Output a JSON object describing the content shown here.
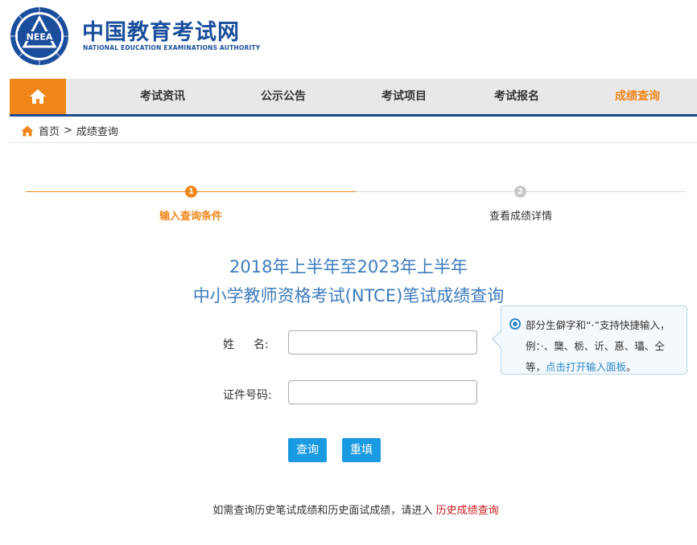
{
  "header": {
    "logo_cn": "中国教育考试网",
    "logo_en": "NATIONAL EDUCATION EXAMINATIONS AUTHORITY",
    "emblem_text": "NEEA",
    "brand_color": "#1a4e9c"
  },
  "nav": {
    "home_icon": "home-icon",
    "items": [
      {
        "label": "考试资讯"
      },
      {
        "label": "公示公告"
      },
      {
        "label": "考试项目"
      },
      {
        "label": "考试报名"
      },
      {
        "label": "成绩查询"
      }
    ],
    "active_color": "#f08519"
  },
  "breadcrumb": {
    "home": "首页",
    "separator": ">",
    "current": "成绩查询"
  },
  "steps": [
    {
      "num": "1",
      "label": "输入查询条件"
    },
    {
      "num": "2",
      "label": "查看成绩详情"
    }
  ],
  "title": {
    "line1": "2018年上半年至2023年上半年",
    "line2": "中小学教师资格考试(NTCE)笔试成绩查询"
  },
  "form": {
    "name_label_a": "姓",
    "name_label_b": "名:",
    "name_value": "",
    "id_label": "证件号码:",
    "id_value": ""
  },
  "tooltip": {
    "text": "部分生僻字和“·”支持快捷输入，例：·、龑、栃、䜣、惪、瓃、仝等，",
    "link": "点击打开输入面板",
    "end": "。"
  },
  "buttons": {
    "query": "查询",
    "reset": "重填"
  },
  "note": {
    "text": "如需查询历史笔试成绩和历史面试成绩，请进入",
    "link": "历史成绩查询"
  }
}
